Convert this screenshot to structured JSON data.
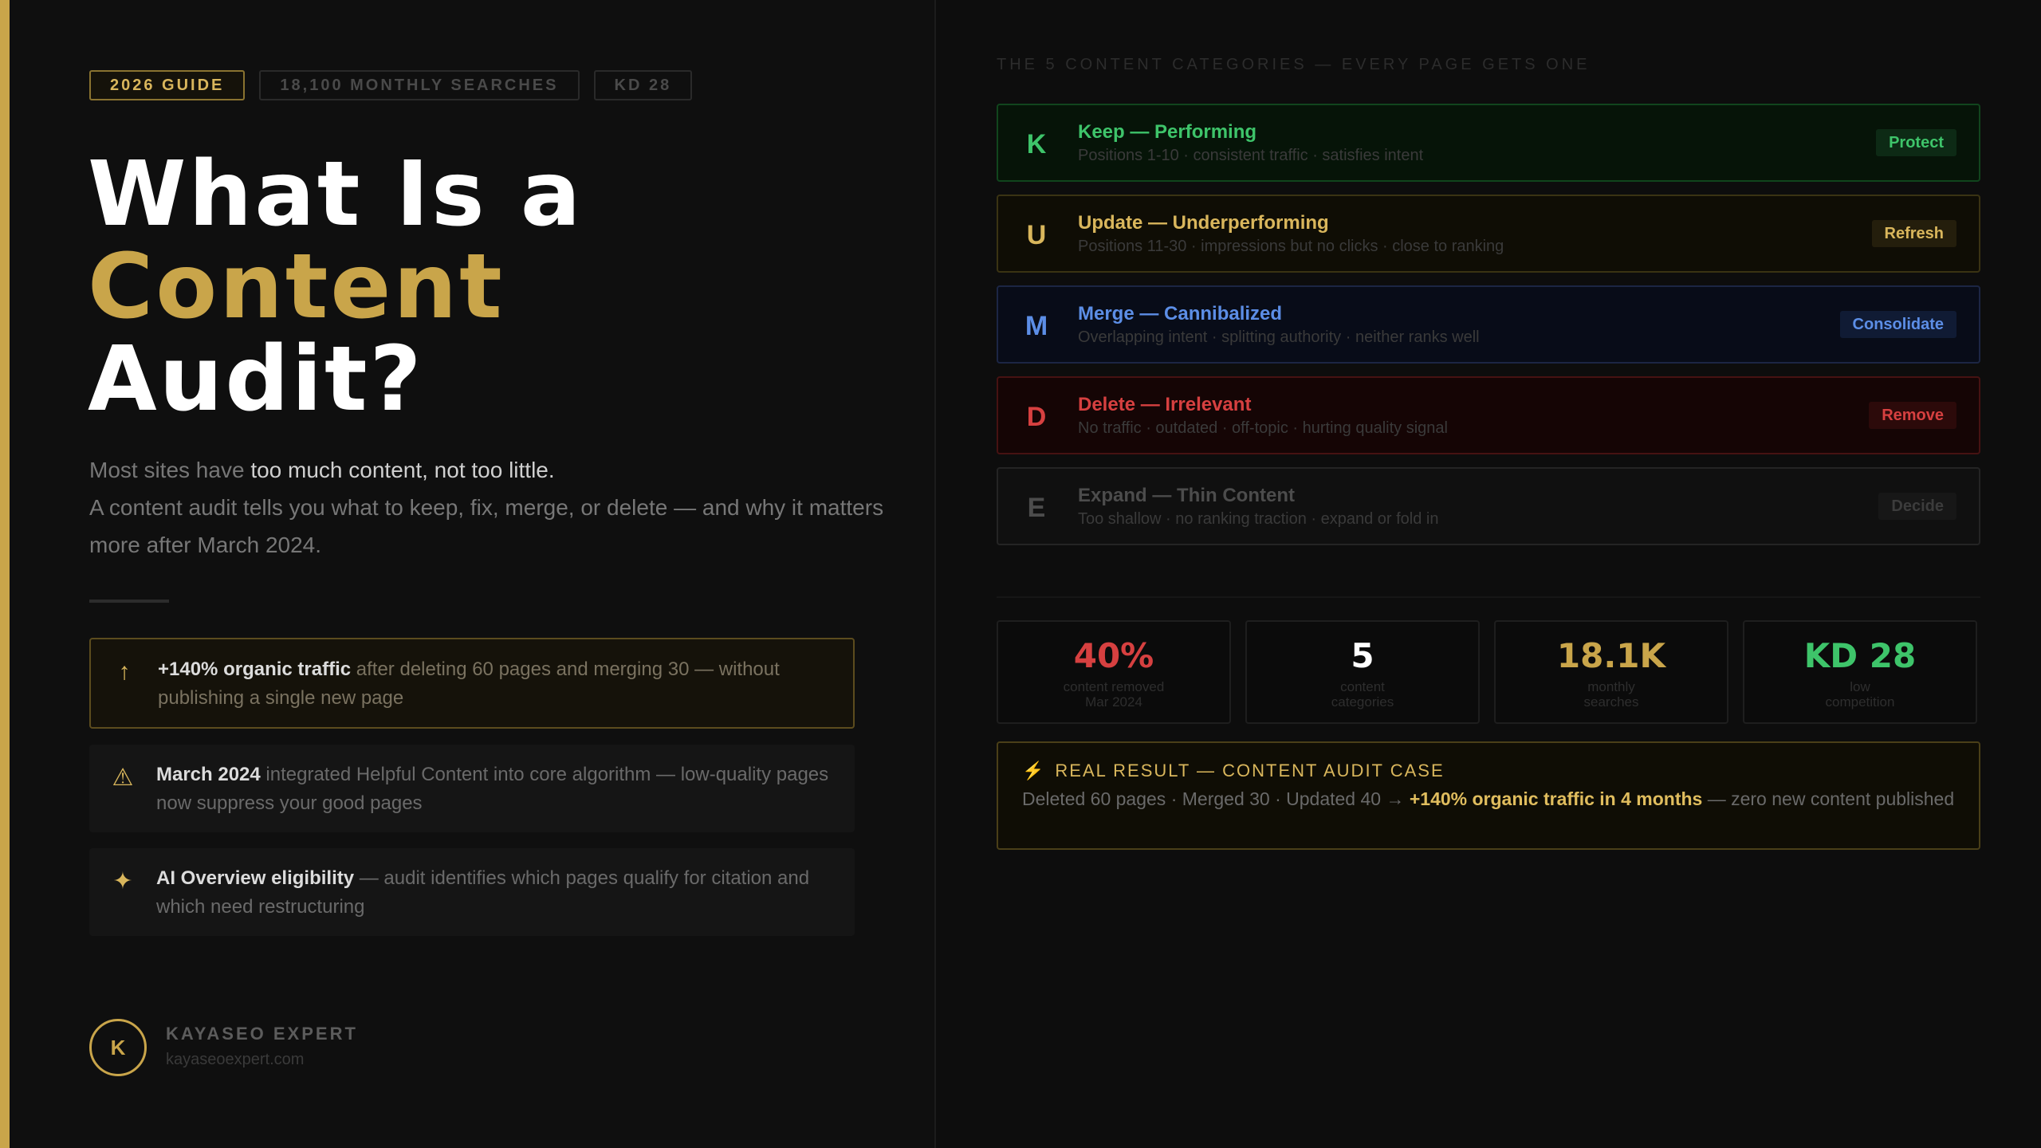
{
  "tags": [
    "2026 GUIDE",
    "18,100 MONTHLY SEARCHES",
    "KD 28"
  ],
  "title": {
    "line1": "What Is a",
    "line2": "Content",
    "line3": "Audit?"
  },
  "intro": {
    "pre": "Most sites have ",
    "highlight": "too much content, not too little.",
    "line2": "A content audit tells you what to keep, fix, merge, or delete — and why it matters more after March 2024."
  },
  "facts": [
    {
      "icon": "↑",
      "icon_name": "arrow-up-icon",
      "bold": "+140% organic traffic",
      "text": " after deleting 60 pages and merging 30 — without publishing a single new page"
    },
    {
      "icon": "⚠",
      "icon_name": "warning-icon",
      "bold": "March 2024",
      "text": " integrated Helpful Content into core algorithm — low-quality pages now suppress your good pages"
    },
    {
      "icon": "✦",
      "icon_name": "sparkle-icon",
      "bold": "AI Overview eligibility",
      "text": " — audit identifies which pages qualify for citation and which need restructuring"
    }
  ],
  "brand": {
    "logo_letter": "K",
    "name": "KAYASEO EXPERT",
    "url": "kayaseoexpert.com"
  },
  "categories_label": "THE 5 CONTENT CATEGORIES — EVERY PAGE GETS ONE",
  "categories": [
    {
      "letter": "K",
      "name": "Keep — Performing",
      "desc": "Positions 1-10 · consistent traffic · satisfies intent",
      "action": "Protect",
      "color": "#3ec46a"
    },
    {
      "letter": "U",
      "name": "Update — Underperforming",
      "desc": "Positions 11-30 · impressions but no clicks · close to ranking",
      "action": "Refresh",
      "color": "#d9b65c"
    },
    {
      "letter": "M",
      "name": "Merge — Cannibalized",
      "desc": "Overlapping intent · splitting authority · neither ranks well",
      "action": "Consolidate",
      "color": "#5c8ee6"
    },
    {
      "letter": "D",
      "name": "Delete — Irrelevant",
      "desc": "No traffic · outdated · off-topic · hurting quality signal",
      "action": "Remove",
      "color": "#d64040"
    },
    {
      "letter": "E",
      "name": "Expand — Thin Content",
      "desc": "Too shallow · no ranking traction · expand or fold in",
      "action": "Decide",
      "color": "#4c4c4c"
    }
  ],
  "stats": [
    {
      "value": "40%",
      "label1": "content removed",
      "label2": "Mar 2024"
    },
    {
      "value": "5",
      "label1": "content",
      "label2": "categories"
    },
    {
      "value": "18.1K",
      "label1": "monthly",
      "label2": "searches"
    },
    {
      "value": "KD 28",
      "label1": "low",
      "label2": "competition"
    }
  ],
  "result": {
    "icon": "⚡",
    "icon_name": "lightning-icon",
    "heading": "REAL RESULT — CONTENT AUDIT CASE",
    "pre": "Deleted 60 pages · Merged 30 · Updated 40 → ",
    "bold": "+140% organic traffic in 4 months",
    "post": " — zero new content published"
  },
  "colors": {
    "accent": "#c9a54a",
    "green": "#3ec46a",
    "blue": "#5c8ee6",
    "red": "#d64040",
    "background": "#0c0c0c"
  }
}
